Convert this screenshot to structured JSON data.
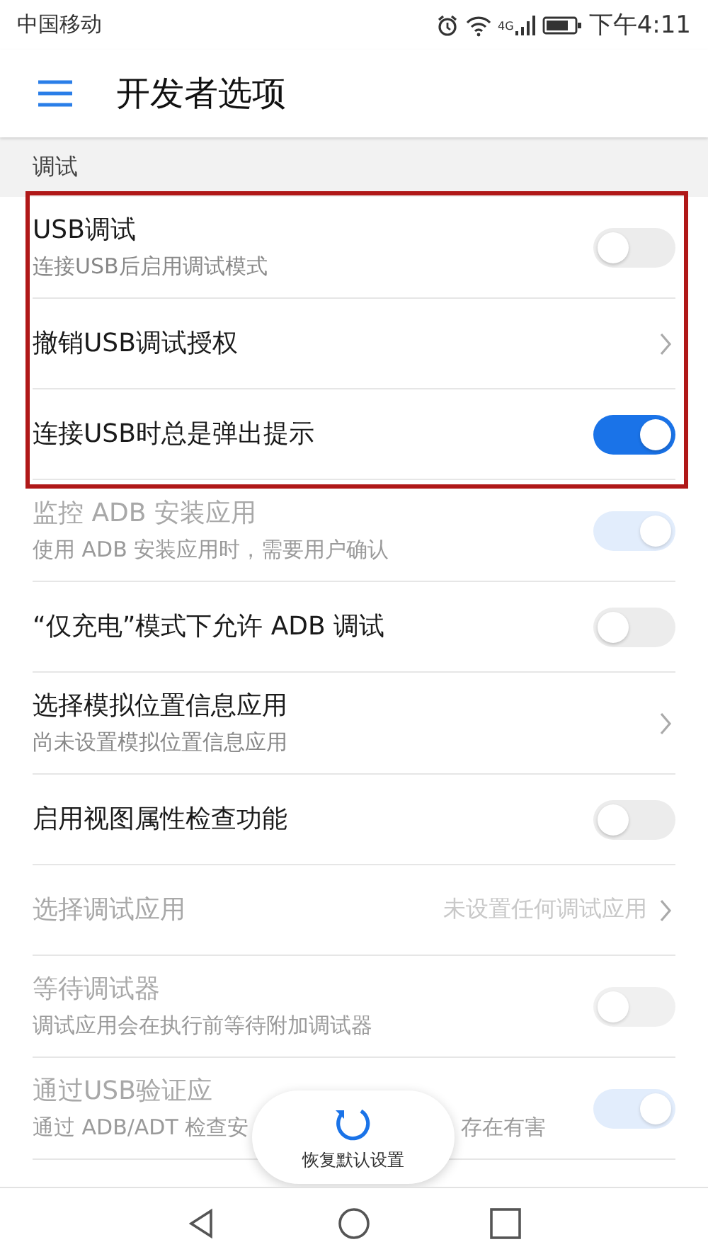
{
  "status_bar": {
    "carrier": "中国移动",
    "network": "4G",
    "time": "下午4:11"
  },
  "toolbar": {
    "title": "开发者选项"
  },
  "section": {
    "title": "调试"
  },
  "rows": [
    {
      "kind": "toggle",
      "title": "USB调试",
      "subtitle": "连接USB后启用调试模式",
      "disabled": false,
      "on": false,
      "highlighted": true
    },
    {
      "kind": "chevron",
      "title": "撤销USB调试授权",
      "disabled": false,
      "highlighted": true
    },
    {
      "kind": "toggle",
      "title": "连接USB时总是弹出提示",
      "disabled": false,
      "on": true,
      "highlighted": true
    },
    {
      "kind": "toggle",
      "title": "监控 ADB 安装应用",
      "subtitle": "使用 ADB 安装应用时，需要用户确认",
      "disabled": true,
      "on": true
    },
    {
      "kind": "toggle",
      "title": "“仅充电”模式下允许 ADB 调试",
      "disabled": false,
      "on": false
    },
    {
      "kind": "chevron",
      "title": "选择模拟位置信息应用",
      "subtitle": "尚未设置模拟位置信息应用",
      "disabled": false
    },
    {
      "kind": "toggle",
      "title": "启用视图属性检查功能",
      "disabled": false,
      "on": false
    },
    {
      "kind": "value",
      "title": "选择调试应用",
      "value": "未设置任何调试应用",
      "disabled": true
    },
    {
      "kind": "toggle",
      "title": "等待调试器",
      "subtitle": "调试应用会在执行前等待附加调试器",
      "disabled": true,
      "on": false
    },
    {
      "kind": "toggle",
      "title": "通过USB验证应",
      "subtitle_parts": [
        "通过 ADB/ADT 检查安",
        "存在有害"
      ],
      "disabled": true,
      "on": true
    }
  ],
  "toast": {
    "label": "恢复默认设置"
  }
}
